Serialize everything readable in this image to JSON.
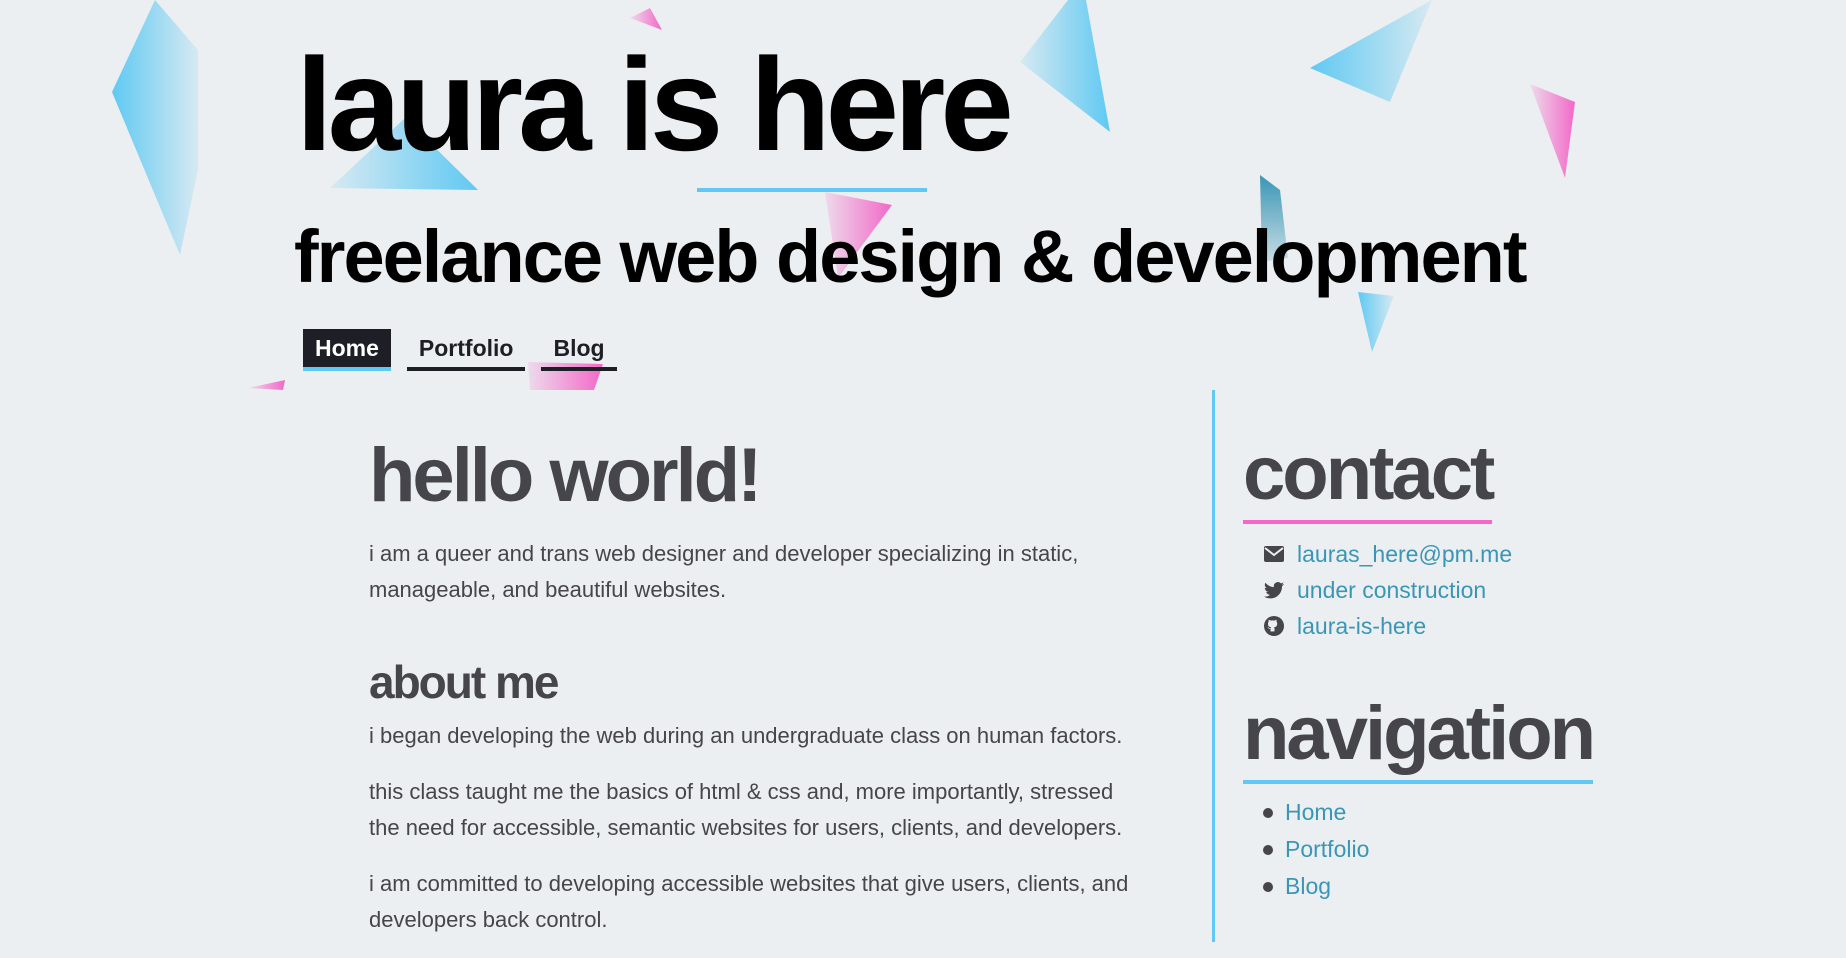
{
  "header": {
    "title": "laura is here",
    "subtitle": "freelance web design & development",
    "nav": [
      {
        "label": "Home",
        "active": true
      },
      {
        "label": "Portfolio",
        "active": false
      },
      {
        "label": "Blog",
        "active": false
      }
    ]
  },
  "main": {
    "heading": "hello world!",
    "intro": "i am a queer and trans web designer and developer specializing in static, manageable, and beautiful websites.",
    "about_heading": "about me",
    "about_paragraphs": [
      "i began developing the web during an undergraduate class on human factors.",
      "this class taught me the basics of html & css and, more importantly, stressed the need for accessible, semantic websites for users, clients, and developers.",
      "i am committed to developing accessible websites that give users, clients, and developers back control."
    ]
  },
  "sidebar": {
    "contact_heading": "contact",
    "contact": [
      {
        "icon": "envelope-icon",
        "label": "lauras_here@pm.me"
      },
      {
        "icon": "twitter-icon",
        "label": "under construction"
      },
      {
        "icon": "github-icon",
        "label": "laura-is-here"
      }
    ],
    "navigation_heading": "navigation",
    "navigation": [
      "Home",
      "Portfolio",
      "Blog"
    ]
  },
  "colors": {
    "background": "#eceff1",
    "accent_blue": "#5fc9f3",
    "accent_pink": "#f368c8",
    "link": "#3a96b6",
    "text": "#45454b",
    "dark": "#1e1f26"
  }
}
